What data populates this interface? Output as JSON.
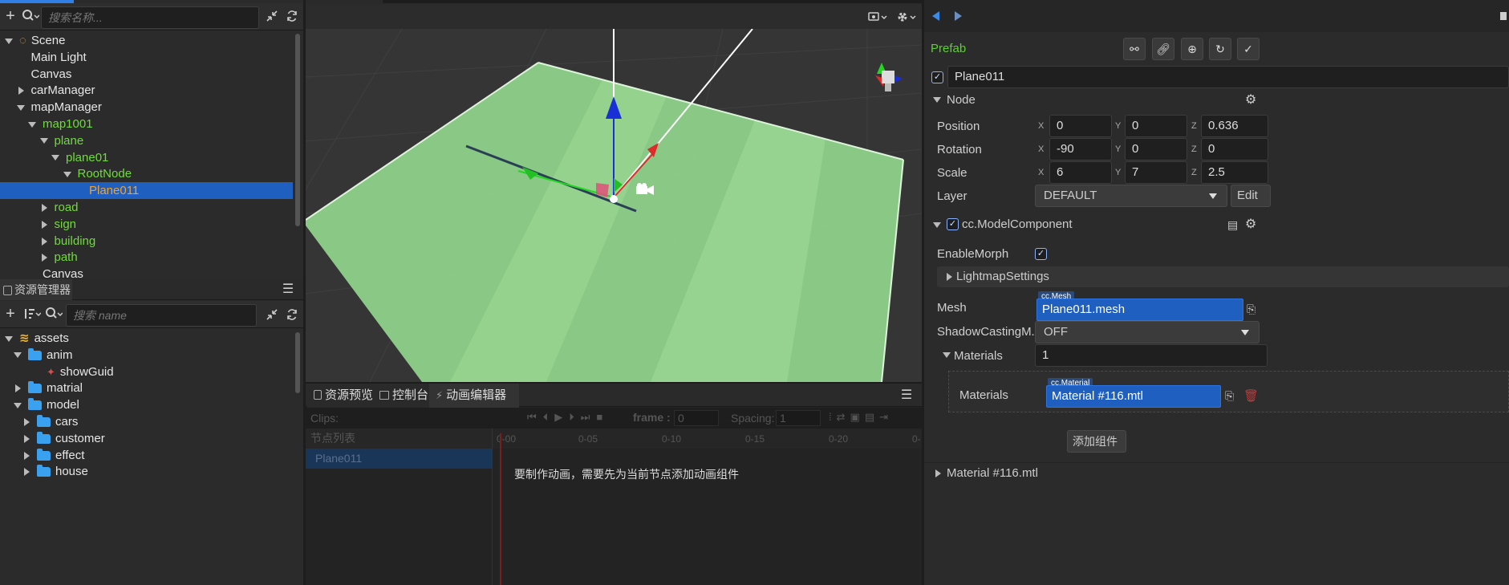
{
  "hierarchy": {
    "search_placeholder": "搜索名称...",
    "items": [
      {
        "label": "Scene",
        "depth": 0,
        "arrow": "down",
        "color": "white",
        "icon": "scene-icon"
      },
      {
        "label": "Main Light",
        "depth": 1,
        "arrow": "none",
        "color": "white"
      },
      {
        "label": "Canvas",
        "depth": 1,
        "arrow": "none",
        "color": "white"
      },
      {
        "label": "carManager",
        "depth": 1,
        "arrow": "right",
        "color": "white"
      },
      {
        "label": "mapManager",
        "depth": 1,
        "arrow": "down",
        "color": "white"
      },
      {
        "label": "map1001",
        "depth": 2,
        "arrow": "down",
        "color": "green"
      },
      {
        "label": "plane",
        "depth": 3,
        "arrow": "down",
        "color": "green"
      },
      {
        "label": "plane01",
        "depth": 4,
        "arrow": "down",
        "color": "green"
      },
      {
        "label": "RootNode",
        "depth": 5,
        "arrow": "down",
        "color": "green"
      },
      {
        "label": "Plane011",
        "depth": 6,
        "arrow": "none",
        "color": "orange",
        "selected": true
      },
      {
        "label": "road",
        "depth": 3,
        "arrow": "right",
        "color": "green"
      },
      {
        "label": "sign",
        "depth": 3,
        "arrow": "right",
        "color": "green"
      },
      {
        "label": "building",
        "depth": 3,
        "arrow": "right",
        "color": "green"
      },
      {
        "label": "path",
        "depth": 3,
        "arrow": "right",
        "color": "green"
      },
      {
        "label": "Canvas",
        "depth": 2,
        "arrow": "none",
        "color": "white"
      }
    ]
  },
  "assets": {
    "title": "资源管理器",
    "search_placeholder": "搜索 name",
    "items": [
      {
        "label": "assets",
        "depth": 0,
        "arrow": "down",
        "icon": "database-icon"
      },
      {
        "label": "anim",
        "depth": 1,
        "arrow": "down",
        "icon": "folder-icon"
      },
      {
        "label": "showGuid",
        "depth": 2,
        "arrow": "none",
        "icon": "animation-clip-icon"
      },
      {
        "label": "matrial",
        "depth": 1,
        "arrow": "right",
        "icon": "folder-icon"
      },
      {
        "label": "model",
        "depth": 1,
        "arrow": "down",
        "icon": "folder-icon"
      },
      {
        "label": "cars",
        "depth": 2,
        "arrow": "right",
        "icon": "folder-icon"
      },
      {
        "label": "customer",
        "depth": 2,
        "arrow": "right",
        "icon": "folder-icon"
      },
      {
        "label": "effect",
        "depth": 2,
        "arrow": "right",
        "icon": "folder-icon"
      },
      {
        "label": "house",
        "depth": 2,
        "arrow": "right",
        "icon": "folder-icon"
      }
    ]
  },
  "bottom_panel": {
    "tabs": [
      {
        "label": "资源预览",
        "icon": "preview-icon"
      },
      {
        "label": "控制台",
        "icon": "console-icon"
      },
      {
        "label": "动画编辑器",
        "icon": "animation-icon",
        "active": true
      }
    ],
    "clips_label": "Clips:",
    "frame_label": "frame :",
    "frame_value": "0",
    "spacing_label": "Spacing:",
    "spacing_value": "1",
    "node_list_label": "节点列表",
    "node_item": "Plane011",
    "timeline_ticks": [
      "0-00",
      "0-05",
      "0-10",
      "0-15",
      "0-20",
      "0-"
    ],
    "hint": "要制作动画，需要先为当前节点添加动画组件"
  },
  "inspector": {
    "prefab_label": "Prefab",
    "node_name": "Plane011",
    "node_section": "Node",
    "position": {
      "label": "Position",
      "x": "0",
      "y": "0",
      "z": "0.636"
    },
    "rotation": {
      "label": "Rotation",
      "x": "-90",
      "y": "0",
      "z": "0"
    },
    "scale": {
      "label": "Scale",
      "x": "6",
      "y": "7",
      "z": "2.5"
    },
    "layer": {
      "label": "Layer",
      "value": "DEFAULT",
      "edit": "Edit"
    },
    "model_component": "cc.ModelComponent",
    "enable_morph": "EnableMorph",
    "lightmap": "LightmapSettings",
    "mesh": {
      "label": "Mesh",
      "tag": "cc.Mesh",
      "value": "Plane011.mesh"
    },
    "shadow": {
      "label": "ShadowCastingM...",
      "value": "OFF"
    },
    "materials": {
      "label": "Materials",
      "count": "1"
    },
    "material_item": {
      "label": "Materials",
      "tag": "cc.Material",
      "value": "Material #116.mtl"
    },
    "add_component": "添加组件",
    "material_section": "Material #116.mtl"
  },
  "colors": {
    "selected_row": "#1f5fbf",
    "green_text": "#6fdc3c",
    "orange_text": "#f0a330",
    "plane": "#8fd18a"
  }
}
